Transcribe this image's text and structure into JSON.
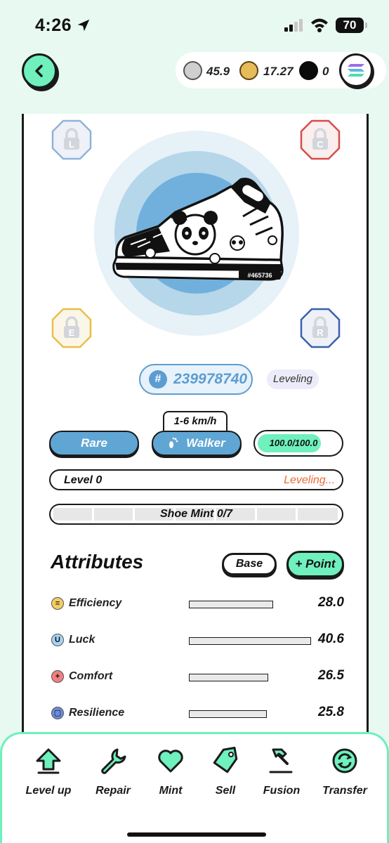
{
  "status_bar": {
    "time": "4:26",
    "battery": "70"
  },
  "header": {
    "back_icon": "chevron-left-icon",
    "wallet": {
      "gst": "45.9",
      "gmt": "17.27",
      "sol": "0"
    },
    "accent": "#6ff0bd"
  },
  "sneaker": {
    "sockets": [
      {
        "letter": "L",
        "color": "#8fb3d9"
      },
      {
        "letter": "C",
        "color": "#d94a4a"
      },
      {
        "letter": "E",
        "color": "#e7c04a"
      },
      {
        "letter": "R",
        "color": "#3a5fae"
      }
    ],
    "serial_on_shoe": "#465736",
    "id_hash": "#",
    "id": "239978740",
    "state": "Leveling",
    "speed_range": "1-6 km/h",
    "quality": "Rare",
    "type": "Walker",
    "durability": "100.0/100.0",
    "durability_fraction": 1.0,
    "level": "Level 0",
    "level_status": "Leveling...",
    "shoe_mint": "Shoe Mint 0/7",
    "quality_color": "#5fa6d4"
  },
  "attributes": {
    "title": "Attributes",
    "base_label": "Base",
    "point_label": "+ Point",
    "items": [
      {
        "name": "Efficiency",
        "value": "28.0",
        "fraction": 0.69,
        "icon": "efficiency-icon",
        "glyph": "≡",
        "color": "#f2cd62"
      },
      {
        "name": "Luck",
        "value": "40.6",
        "fraction": 1.0,
        "icon": "luck-icon",
        "glyph": "U",
        "color": "#a8d2f3"
      },
      {
        "name": "Comfort",
        "value": "26.5",
        "fraction": 0.65,
        "icon": "comfort-icon",
        "glyph": "+",
        "color": "#f08080"
      },
      {
        "name": "Resilience",
        "value": "25.8",
        "fraction": 0.64,
        "icon": "resilience-icon",
        "glyph": "▢",
        "color": "#6d8cd9"
      }
    ]
  },
  "toolbar": {
    "items": [
      {
        "label": "Level up",
        "icon": "level-up-icon"
      },
      {
        "label": "Repair",
        "icon": "wrench-icon"
      },
      {
        "label": "Mint",
        "icon": "heart-icon"
      },
      {
        "label": "Sell",
        "icon": "tag-icon"
      },
      {
        "label": "Fusion",
        "icon": "hammer-icon"
      },
      {
        "label": "Transfer",
        "icon": "transfer-icon"
      }
    ]
  }
}
